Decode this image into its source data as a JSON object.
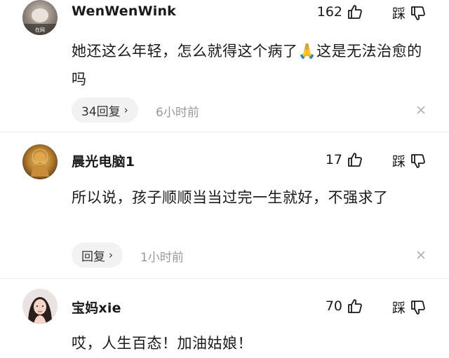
{
  "comments": [
    {
      "username": "WenWenWink",
      "avatar_badge": "在网",
      "likes": "162",
      "dislike_label": "踩",
      "text": "她还这么年轻，怎么就得这个病了🙏这是无法治愈的吗",
      "reply_label": "34回复",
      "time": "6小时前"
    },
    {
      "username": "晨光电脑1",
      "likes": "17",
      "dislike_label": "踩",
      "text": "所以说，孩子顺顺当当过完一生就好，不强求了",
      "reply_label": "回复",
      "time": "1小时前"
    },
    {
      "username": "宝妈xie",
      "likes": "70",
      "dislike_label": "踩",
      "text": "哎，人生百态！加油姑娘！"
    }
  ],
  "icons": {
    "like": "thumbs-up-icon",
    "dislike": "thumbs-down-icon",
    "close": "close-icon",
    "chevron": "chevron-right-icon"
  },
  "colors": {
    "text": "#1a1a1a",
    "muted": "#999999",
    "pill_bg": "#f2f2f2"
  }
}
